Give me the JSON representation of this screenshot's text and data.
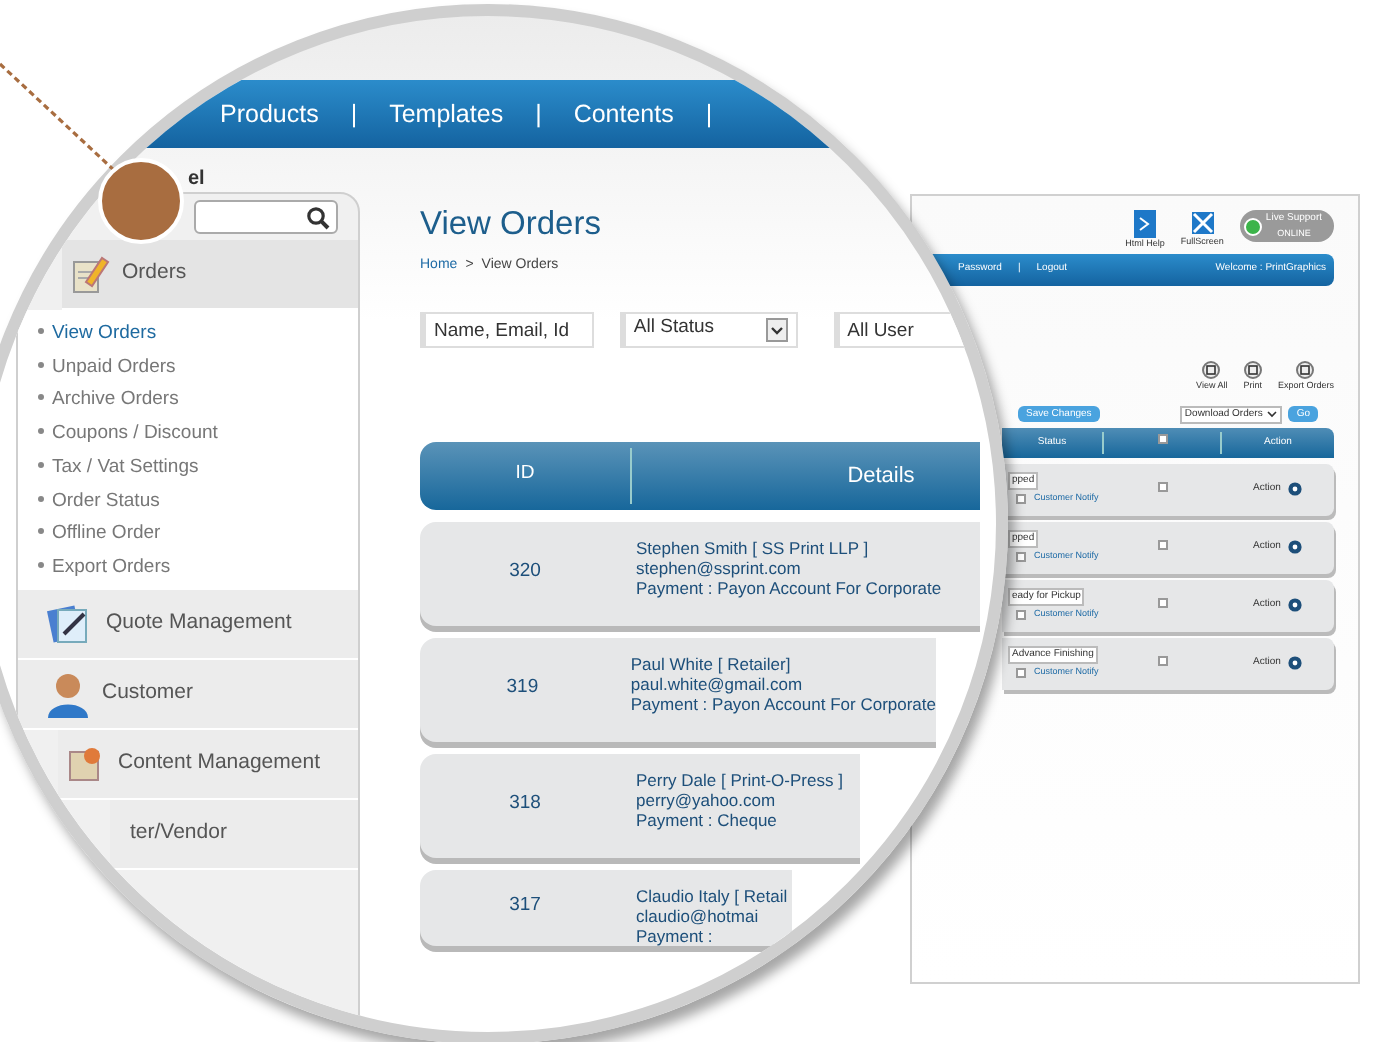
{
  "nav": [
    "Products",
    "|",
    "Templates",
    "|",
    "Contents",
    "|"
  ],
  "panel_label": "el",
  "sidebar": {
    "sections": [
      {
        "title": "Orders",
        "expanded": true,
        "items": [
          {
            "label": "View Orders",
            "selected": true
          },
          {
            "label": "Unpaid Orders",
            "selected": false
          },
          {
            "label": "Archive Orders",
            "selected": false
          },
          {
            "label": "Coupons / Discount",
            "selected": false
          },
          {
            "label": "Tax / Vat Settings",
            "selected": false
          },
          {
            "label": "Order Status",
            "selected": false
          },
          {
            "label": "Offline Order",
            "selected": false
          },
          {
            "label": "Export Orders",
            "selected": false
          }
        ]
      },
      {
        "title": "Quote Management",
        "expanded": false
      },
      {
        "title": "Customer",
        "expanded": false
      },
      {
        "title": "Content Management",
        "expanded": false
      },
      {
        "title": "ter/Vendor",
        "expanded": false
      }
    ]
  },
  "page": {
    "title": "View Orders",
    "breadcrumb": {
      "home": "Home",
      "separator": ">",
      "current": "View Orders"
    }
  },
  "filters": {
    "search": {
      "value": "Name, Email, Id"
    },
    "status": {
      "value": "All Status"
    },
    "user": {
      "value": "All User"
    }
  },
  "table": {
    "columns": [
      "ID",
      "Details"
    ],
    "rows": [
      {
        "id": "320",
        "details": [
          "Stephen Smith [ SS Print LLP ]",
          "stephen@ssprint.com",
          "Payment : Payon Account For Corporate"
        ]
      },
      {
        "id": "319",
        "details": [
          "Paul White [ Retailer]",
          "paul.white@gmail.com",
          "Payment : Payon Account For Corporate"
        ]
      },
      {
        "id": "318",
        "details": [
          "Perry Dale [ Print-O-Press ]",
          "perry@yahoo.com",
          "Payment : Cheque"
        ]
      },
      {
        "id": "317",
        "details": [
          "Claudio Italy [ Retail",
          "claudio@hotmai",
          "Payment :"
        ]
      }
    ]
  },
  "background_window": {
    "help": "Html Help",
    "fullscreen": "FullScreen",
    "live_support": "Live Support",
    "support_status": "ONLINE",
    "menu": [
      "Password",
      "|",
      "Logout"
    ],
    "welcome": "Welcome : PrintGraphics",
    "tools": [
      "View All",
      "Print",
      "Export Orders"
    ],
    "save": "Save Changes",
    "download": "Download Orders",
    "go": "Go",
    "columns": [
      "Status",
      "Action"
    ],
    "select_all_checked": false,
    "rows": [
      {
        "status": "pped",
        "notify": "Customer Notify",
        "notify_checked": false,
        "checked": false,
        "action": "Action"
      },
      {
        "status": "pped",
        "notify": "Customer Notify",
        "notify_checked": false,
        "checked": false,
        "action": "Action"
      },
      {
        "status": "eady for Pickup",
        "notify": "Customer Notify",
        "notify_checked": false,
        "checked": false,
        "action": "Action"
      },
      {
        "status": "Advance Finishing",
        "notify": "Customer Notify",
        "notify_checked": false,
        "checked": false,
        "action": "Action"
      }
    ]
  }
}
